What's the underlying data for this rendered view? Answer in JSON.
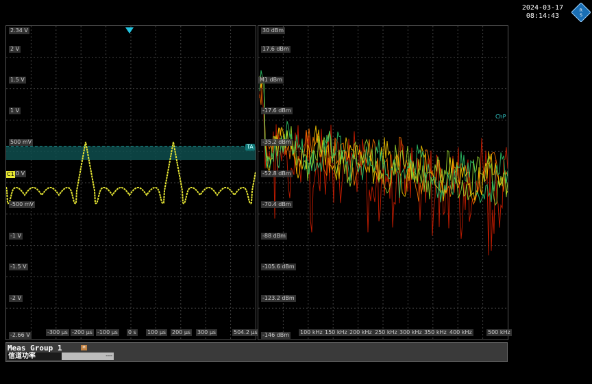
{
  "datetime": {
    "date": "2024-03-17",
    "time": "08:14:43"
  },
  "logo": {
    "icon": "rohde-schwarz-logo-icon"
  },
  "time_panel": {
    "y_labels": [
      "2.34 V",
      "2 V",
      "1.5 V",
      "1 V",
      "500 mV",
      "0 V",
      "-500 mV",
      "-1 V",
      "-1.5 V",
      "-2 V",
      "-2.66 V"
    ],
    "x_labels": [
      "-300 µs",
      "-200 µs",
      "-100 µs",
      "0 s",
      "100 µs",
      "200 µs",
      "300 µs",
      "504.2 µs"
    ],
    "channel_marker": "C1",
    "trigger_marker": "TA",
    "trace_color": "#e6e633",
    "trigger_band_color": "#0e4d4d"
  },
  "fft_panel": {
    "y_labels": [
      "30 dBm",
      "17.6 dBm",
      "M1 dBm",
      "-17.6 dBm",
      "-35.2 dBm",
      "-52.8 dBm",
      "-70.4 dBm",
      "-88 dBm",
      "-105.6 dBm",
      "-123.2 dBm",
      "-146 dBm"
    ],
    "x_labels": [
      "100 kHz",
      "150 kHz",
      "200 kHz",
      "250 kHz",
      "300 kHz",
      "350 kHz",
      "400 kHz",
      "500 kHz"
    ],
    "side_label": "ChP",
    "trace_colors": [
      "#d81e00",
      "#ff7a00",
      "#ffd000",
      "#a0e030",
      "#30d070"
    ]
  },
  "measurement": {
    "title": "Meas Group 1",
    "badge": "M",
    "label": "信道功率",
    "value": "---"
  }
}
